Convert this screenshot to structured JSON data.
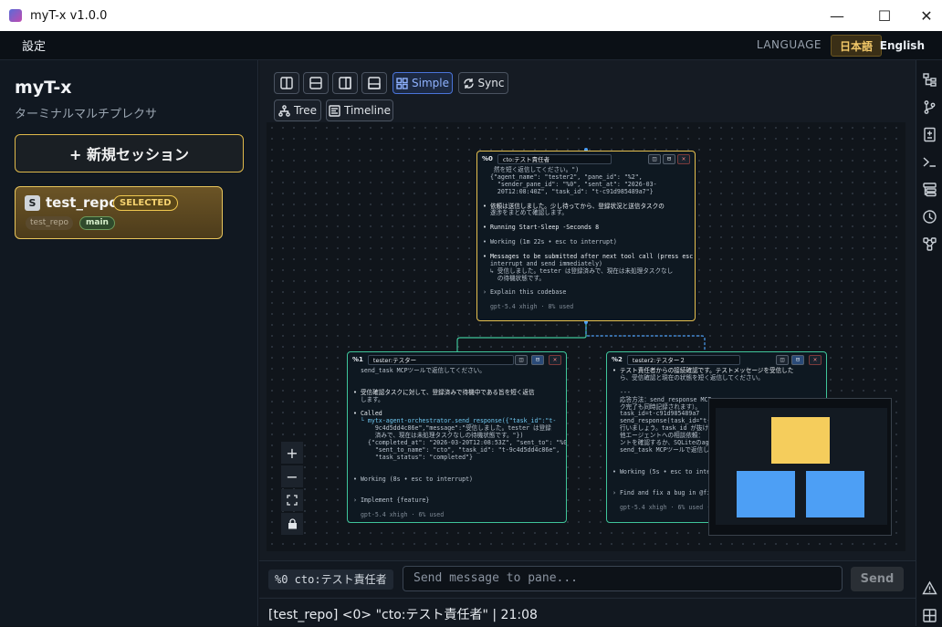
{
  "window": {
    "title": "myT-x v1.0.0",
    "minimize": "—",
    "maximize": "☐",
    "close": "✕"
  },
  "menu": {
    "settings": "設定",
    "language_label": "LANGUAGE",
    "lang_ja": "日本語",
    "lang_en": "English"
  },
  "sidebar": {
    "app_name": "myT-x",
    "subtitle": "ターミナルマルチプレクサ",
    "new_session": "+ 新規セッション",
    "sessions": [
      {
        "badge": "S",
        "name": "test_repo",
        "status": "SELECTED",
        "repo": "test_repo",
        "branch": "main"
      }
    ]
  },
  "toolbar": {
    "simple": "Simple",
    "sync": "Sync",
    "tree": "Tree",
    "timeline": "Timeline"
  },
  "panes": [
    {
      "id": "%0",
      "name": "cto:テスト責任者",
      "lines": [
        "   然を短く返信してください。\")",
        "  {\"agent_name\": \"tester2\", \"pane_id\": \"%2\",",
        "    \"sender_pane_id\": \"%0\", \"sent_at\": \"2026-03-",
        "    20T12:08:40Z\", \"task_id\": \"t-c91d985489a7\"}",
        "",
        "• 依頼は送信しました。少し待ってから、登録状況と送信タスクの",
        "  遂涉をまとめて確認します。",
        "",
        "• Running Start-Sleep -Seconds 8",
        "",
        "• Working (1m 22s • esc to interrupt)",
        "",
        "• Messages to be submitted after next tool call (press esc to",
        "  interrupt and send immediately)",
        "  ↳ 受信しました。tester は登録済みで、現在は未処理タスクなし",
        "    の待機状態です。",
        "",
        "› Explain this codebase",
        "",
        "  gpt-5.4 xhigh · 8% used"
      ]
    },
    {
      "id": "%1",
      "name": "tester:テスター",
      "lines": [
        "  send_task MCPツールで返信してください。",
        "",
        "",
        "• 受信確認タスクに対して、登録済みで待機中である旨を短く返信",
        "  します。",
        "",
        "• Called",
        "  └ mytx-agent-orchestrator.send_response({\"task_id\":\"t-",
        "      9c4d5dd4c86e\",\"message\":\"受信しました。tester は登録",
        "      済みで、現在は未処理タスクなしの待機状態です。\"})",
        "    {\"completed_at\": \"2026-03-20T12:08:53Z\", \"sent_to\": \"%0\",",
        "      \"sent_to_name\": \"cto\", \"task_id\": \"t-9c4d5dd4c86e\",",
        "      \"task_status\": \"completed\"}",
        "",
        "",
        "• Working (8s • esc to interrupt)",
        "",
        "",
        "› Implement {feature}",
        "",
        "  gpt-5.4 xhigh · 6% used"
      ]
    },
    {
      "id": "%2",
      "name": "tester2:テスター２",
      "lines": [
        "• テスト責任者からの接続確認です。テストメッセージを受信した",
        "  ら、受信確認と現在の状態を短く返信してください。",
        "",
        "  ---",
        "  応答方法：send_response MCP",
        "  ク完了も同時記録されます）。",
        "  task_id=t-c91d985489a7",
        "  send_response(task_id=\"t-c9",
        "  行いましょう。task_id が抜け",
        "  他エージェントへの相談依頼：",
        "  ントを確認するか、SQLiteのag",
        "  send_task MCPツールで返信し",
        "",
        "",
        "• Working (5s • esc to interru",
        "",
        "",
        "› Find and fix a bug in @filo",
        "",
        "  gpt-5.4 xhigh · 6% used · 9"
      ]
    }
  ],
  "zoom": {
    "in": "+",
    "out": "−",
    "fit": "⛶",
    "lock": "🔒"
  },
  "colors": {
    "accent_gold": "#e0b94a",
    "active_blue": "#4a74d9",
    "pane_selected_border": "#e6c04f",
    "pane_border": "#3fc59a",
    "minimap_selected": "#f5cd5c",
    "minimap_node": "#4d9ff5"
  },
  "input": {
    "pane_tag": "%0 cto:テスト責任者",
    "placeholder": "Send message to pane...",
    "send": "Send"
  },
  "status": {
    "text": "[test_repo] <0> \"cto:テスト責任者\" | 21:08"
  }
}
